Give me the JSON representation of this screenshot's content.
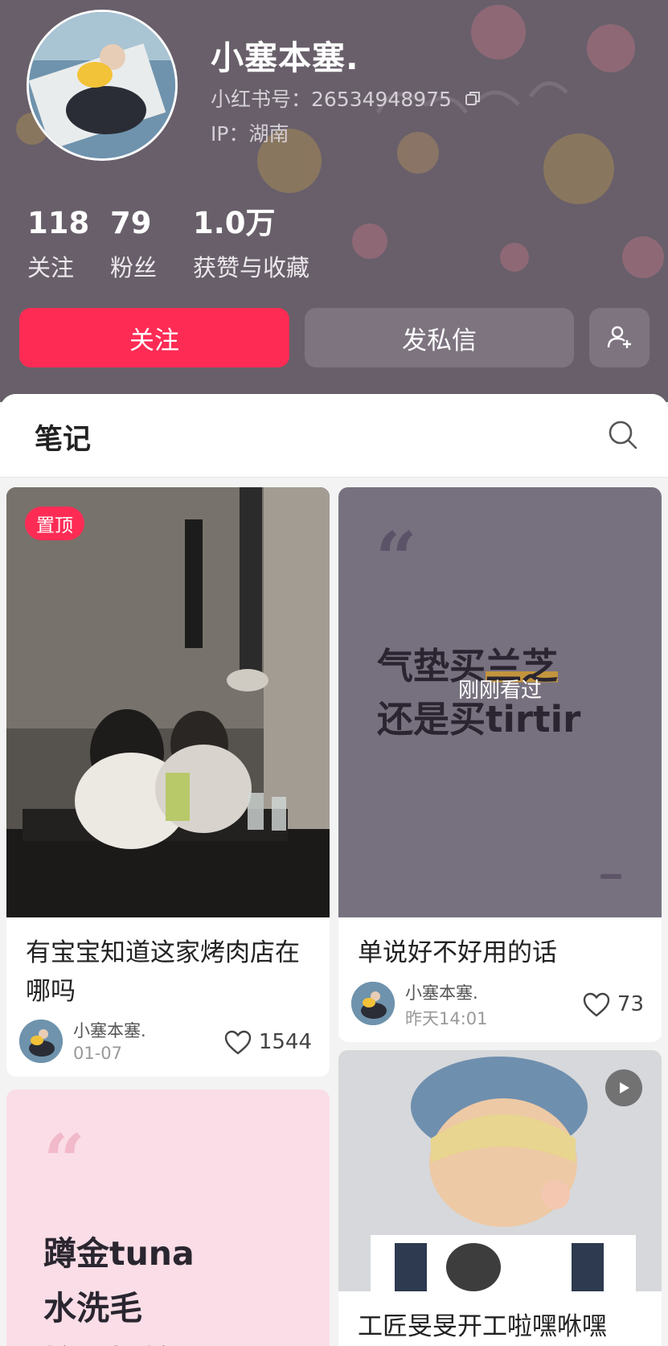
{
  "profile": {
    "username": "小塞本塞.",
    "redbook_id": "小红书号：26534948975",
    "ip_location": "IP：湖南",
    "stats": [
      {
        "value": "118",
        "label": "关注"
      },
      {
        "value": "79",
        "label": "粉丝"
      },
      {
        "value": "1.0万",
        "label": "获赞与收藏"
      }
    ],
    "buttons": {
      "follow": "关注",
      "message": "发私信"
    }
  },
  "notes": {
    "tab_label": "笔记",
    "cards": [
      {
        "badge": "置顶",
        "title": "有宝宝知道这家烤肉店在哪吗",
        "author": "小塞本塞.",
        "date": "01-07",
        "likes": "1544"
      },
      {
        "cover_line1_a": "气垫买",
        "cover_line1_b": "兰芝",
        "cover_line2": "还是买tirtir",
        "overlay": "刚刚看过",
        "title": "单说好不好用的话",
        "author": "小塞本塞.",
        "date": "昨天14:01",
        "likes": "73"
      },
      {
        "cover_lines": [
          "蹲金tuna",
          "水洗毛",
          "摘采摆摘采!"
        ]
      },
      {
        "title": "工匠旻旻开工啦嘿咻嘿"
      }
    ]
  },
  "colors": {
    "accent": "#fe2c55",
    "header_bg": "#685f6a"
  },
  "icons": {
    "copy": "copy-icon",
    "add_friend": "person-add-icon",
    "search": "search-icon",
    "heart": "heart-icon",
    "play": "play-icon"
  }
}
